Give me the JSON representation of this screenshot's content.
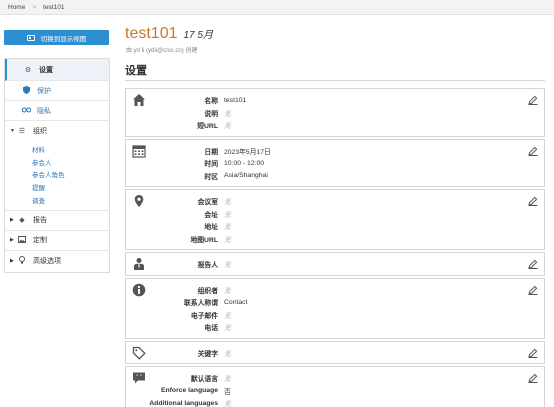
{
  "breadcrumb": {
    "home": "Home",
    "separator": ">",
    "current": "test101"
  },
  "switch_button": {
    "label": "切换到显示视图"
  },
  "sidebar": {
    "settings": "设置",
    "protect": "保护",
    "privacy": "隐私",
    "organize": "组织",
    "organize_items": [
      "材料",
      "参会人",
      "参会人角色",
      "提醒",
      "调查"
    ],
    "report": "报告",
    "customize": "定制",
    "advanced": "高级选项"
  },
  "meeting": {
    "name": "test101",
    "date_badge": "17 5月",
    "byline": "由 yd li (ydli@cnic.cn) 创建"
  },
  "section_heading": "设置",
  "panels": {
    "basic": {
      "icon": "home-icon",
      "rows": [
        {
          "label": "名称",
          "value": "test101"
        },
        {
          "label": "说明",
          "value": "无"
        },
        {
          "label": "短URL",
          "value": "无"
        }
      ]
    },
    "time": {
      "icon": "calendar-icon",
      "rows": [
        {
          "label": "日期",
          "value": "2023年5月17日"
        },
        {
          "label": "时间",
          "value": "10:00 - 12:00"
        },
        {
          "label": "时区",
          "value": "Asia/Shanghai"
        }
      ]
    },
    "location": {
      "icon": "location-pin-icon",
      "rows": [
        {
          "label": "会议室",
          "value": "无"
        },
        {
          "label": "会址",
          "value": "无"
        },
        {
          "label": "地址",
          "value": "无"
        },
        {
          "label": "地图URL",
          "value": "无"
        }
      ]
    },
    "speaker": {
      "icon": "person-icon",
      "rows": [
        {
          "label": "报告人",
          "value": "无"
        }
      ]
    },
    "contact": {
      "icon": "info-icon",
      "rows": [
        {
          "label": "组织者",
          "value": "无"
        },
        {
          "label": "联系人称谓",
          "value": "Contact"
        },
        {
          "label": "电子邮件",
          "value": "无"
        },
        {
          "label": "电话",
          "value": "无"
        }
      ]
    },
    "keywords": {
      "icon": "tag-icon",
      "rows": [
        {
          "label": "关键字",
          "value": "无"
        }
      ]
    },
    "language": {
      "icon": "speech-bubble-icon",
      "rows": [
        {
          "label": "默认语言",
          "value": "无"
        },
        {
          "label": "Enforce language",
          "value": "否"
        },
        {
          "label": "Additional languages",
          "value": "无"
        }
      ]
    }
  },
  "colors": {
    "accent": "#2b8fd2",
    "title": "#c57a2a",
    "link": "#2b78bd"
  }
}
